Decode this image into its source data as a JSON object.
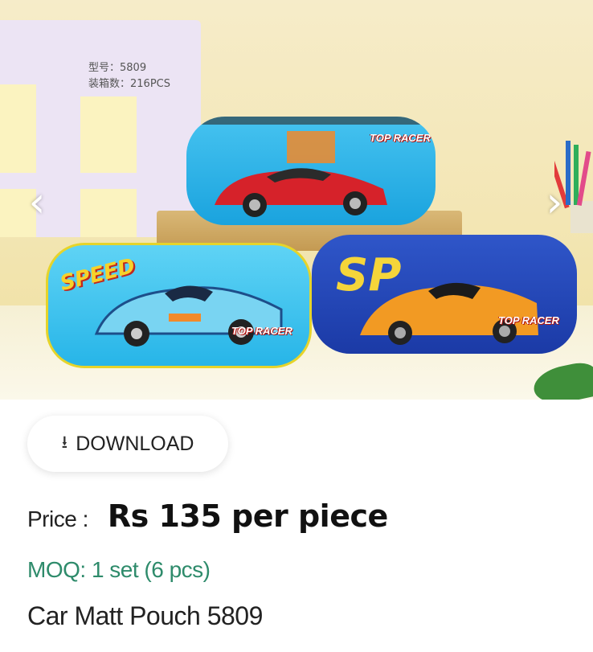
{
  "photo": {
    "tag_lines": [
      "型号：5809",
      "装箱数：216PCS"
    ],
    "pouch_texts": {
      "top_brand": "TOP RACER",
      "left_slogan": "SPEED",
      "right_letters": "SP"
    },
    "prev_icon": "chevron-left-icon",
    "next_icon": "chevron-right-icon"
  },
  "download": {
    "label": "DOWNLOAD",
    "icon": "download-arrow-icon"
  },
  "price": {
    "label": "Price :",
    "value": "Rs 135 per piece"
  },
  "moq": {
    "text": "MOQ: 1 set (6 pcs)"
  },
  "product": {
    "title": "Car Matt Pouch 5809"
  },
  "colors": {
    "moq_green": "#2e8b6b",
    "text_dark": "#222222"
  }
}
